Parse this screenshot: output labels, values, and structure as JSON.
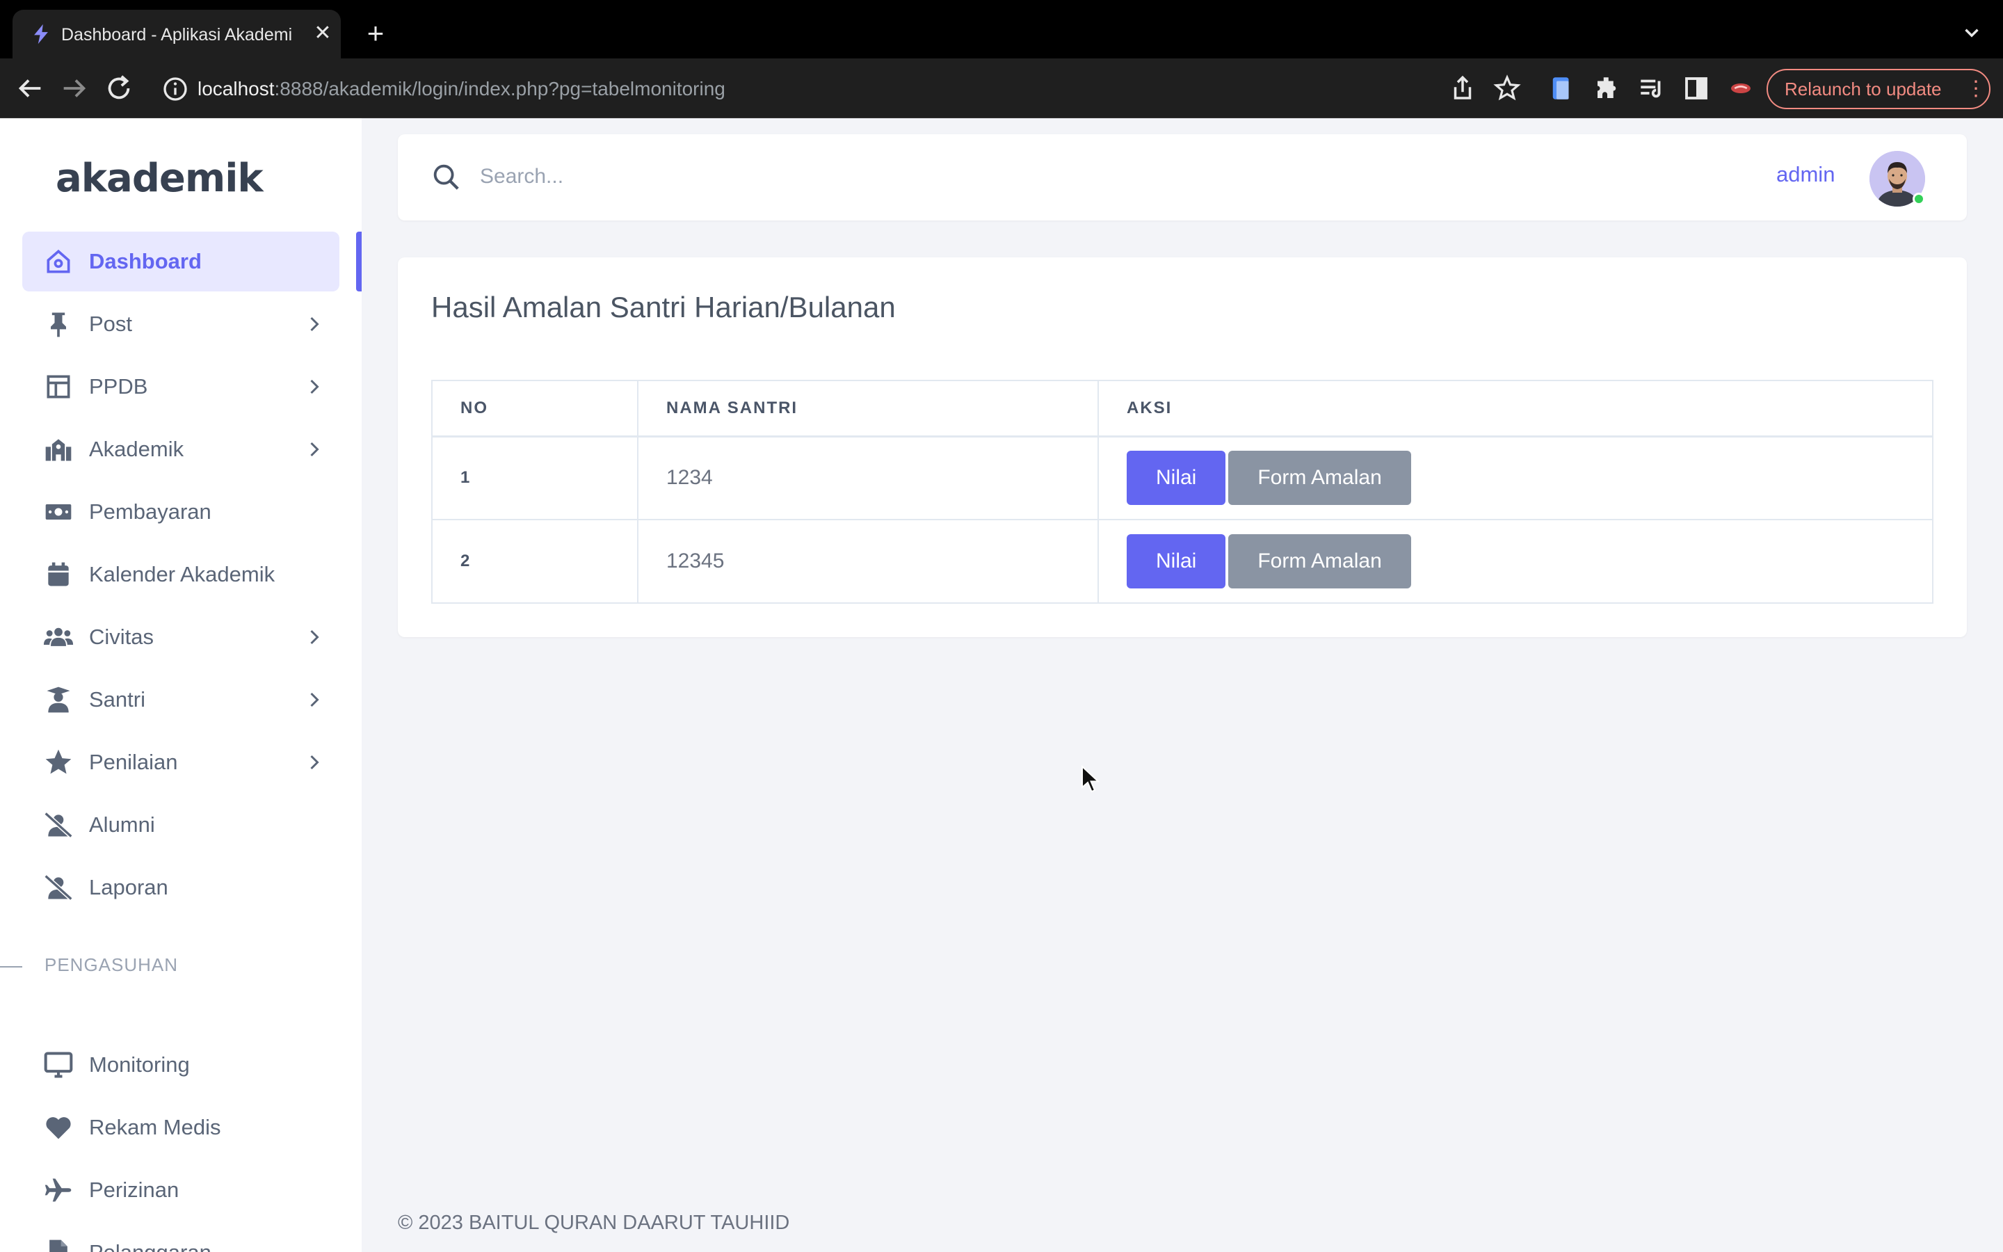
{
  "browser": {
    "tab_title": "Dashboard - Aplikasi Akademi",
    "url_host": "localhost",
    "url_rest": ":8888/akademik/login/index.php?pg=tabelmonitoring",
    "relaunch_label": "Relaunch to update"
  },
  "sidebar": {
    "brand": "akademik",
    "items": [
      {
        "label": "Dashboard",
        "icon": "home-icon"
      },
      {
        "label": "Post",
        "icon": "pin-icon"
      },
      {
        "label": "PPDB",
        "icon": "layout-icon"
      },
      {
        "label": "Akademik",
        "icon": "school-icon"
      },
      {
        "label": "Pembayaran",
        "icon": "money-icon"
      },
      {
        "label": "Kalender Akademik",
        "icon": "calendar-icon"
      },
      {
        "label": "Civitas",
        "icon": "users-icon"
      },
      {
        "label": "Santri",
        "icon": "student-icon"
      },
      {
        "label": "Penilaian",
        "icon": "star-icon"
      },
      {
        "label": "Alumni",
        "icon": "user-slash-icon"
      },
      {
        "label": "Laporan",
        "icon": "user-slash-icon"
      }
    ],
    "section_label": "PENGASUHAN",
    "section_items": [
      {
        "label": "Monitoring",
        "icon": "monitor-icon"
      },
      {
        "label": "Rekam Medis",
        "icon": "heart-icon"
      },
      {
        "label": "Perizinan",
        "icon": "plane-icon"
      },
      {
        "label": "Pelanggaran",
        "icon": "file-icon"
      }
    ]
  },
  "header": {
    "search_placeholder": "Search...",
    "user_name": "admin"
  },
  "main": {
    "title": "Hasil Amalan Santri Harian/Bulanan",
    "columns": [
      "NO",
      "NAMA SANTRI",
      "AKSI"
    ],
    "rows": [
      {
        "no": "1",
        "nama": "1234",
        "btn_nilai": "Nilai",
        "btn_form": "Form Amalan"
      },
      {
        "no": "2",
        "nama": "12345",
        "btn_nilai": "Nilai",
        "btn_form": "Form Amalan"
      }
    ]
  },
  "footer": {
    "text": "© 2023 BAITUL QURAN DAARUT TAUHIID"
  },
  "colors": {
    "accent": "#6366f1",
    "active_bg": "#e8e8ff",
    "secondary_button": "#8a94a3",
    "page_bg": "#f3f4f8",
    "online": "#34d058"
  }
}
